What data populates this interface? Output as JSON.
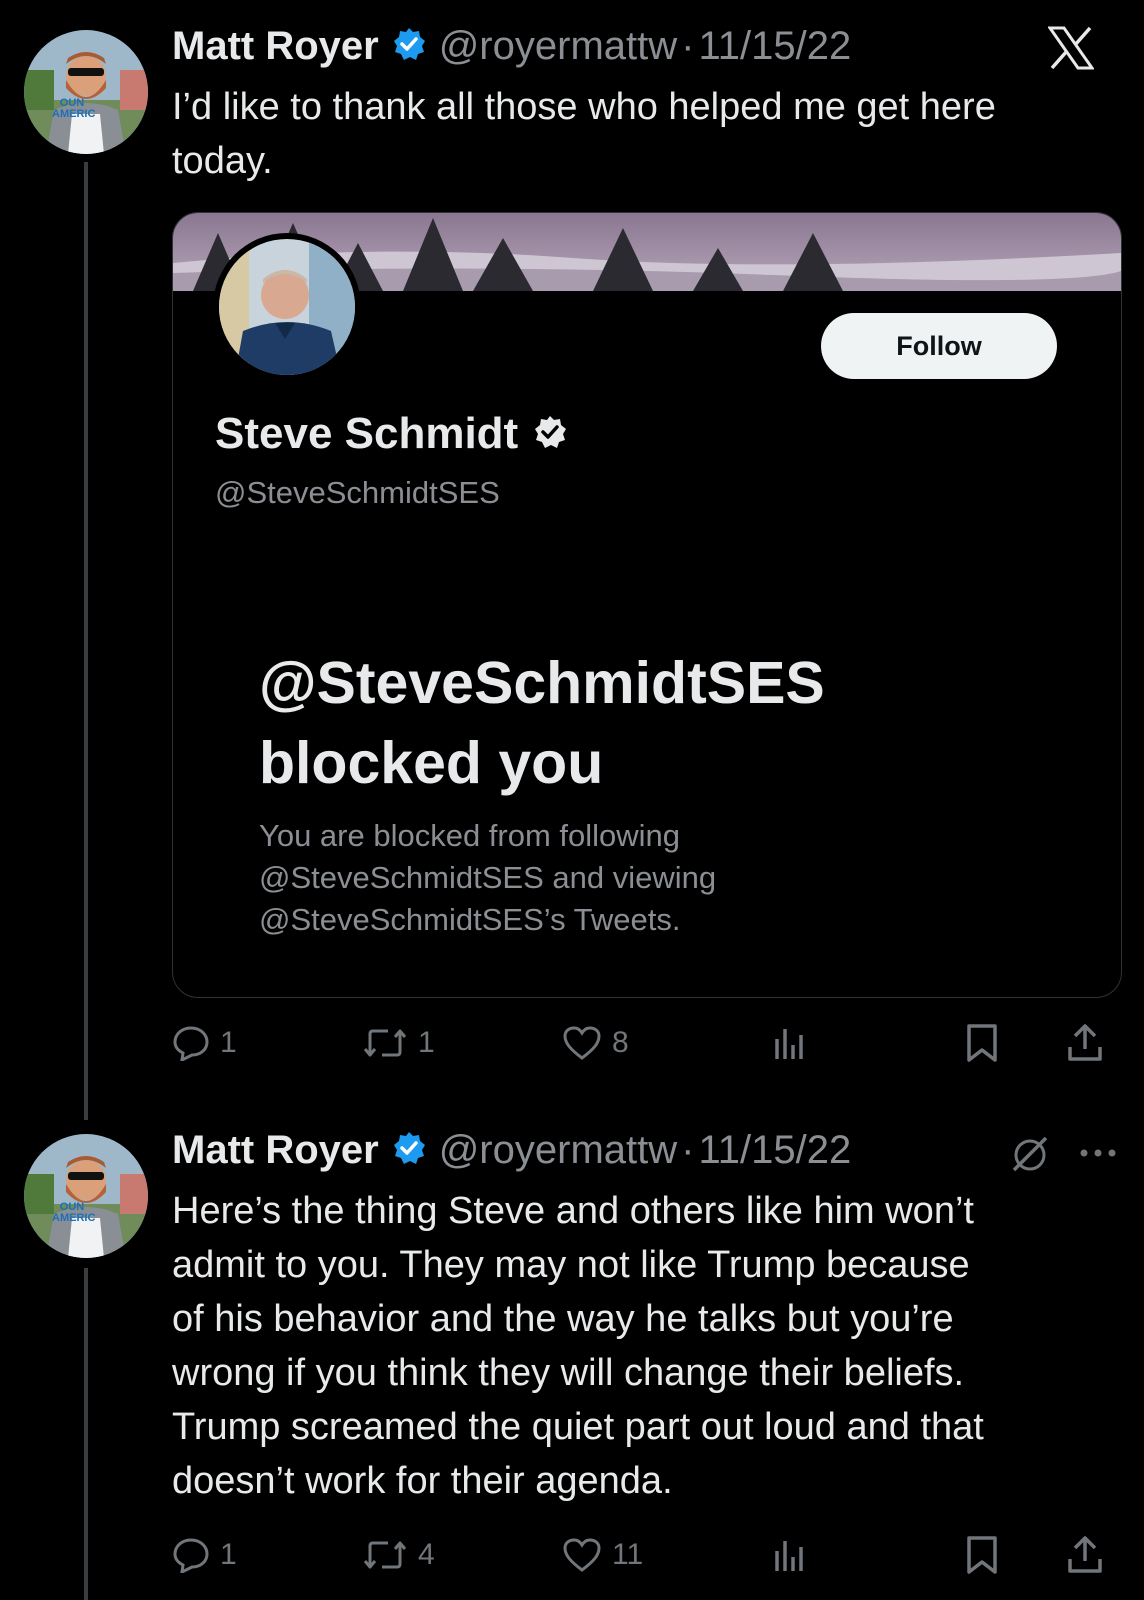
{
  "app": {
    "logo": "x-logo-icon"
  },
  "tweets": [
    {
      "author": "Matt Royer",
      "handle": "@royermattw",
      "separator": "·",
      "date": "11/15/22",
      "text_lines": [
        "I’d like to thank all those who helped me get here",
        "today."
      ],
      "avatar_shirt_text": "OUN\nAMERIC",
      "stats": {
        "replies": "1",
        "retweets": "1",
        "likes": "8"
      }
    },
    {
      "author": "Matt Royer",
      "handle": "@royermattw",
      "separator": "·",
      "date": "11/15/22",
      "text_lines": [
        "Here’s the thing Steve and others like him won’t",
        "admit to you. They may not like Trump because",
        "of his behavior and the way he talks but you’re",
        "wrong if you think they will change their beliefs.",
        "Trump screamed the quiet part out loud and that",
        "doesn’t work for their agenda."
      ],
      "stats": {
        "replies": "1",
        "retweets": "4",
        "likes": "11"
      }
    }
  ],
  "card": {
    "name": "Steve Schmidt",
    "handle": "@SteveSchmidtSES",
    "follow_label": "Follow",
    "blocked_title_line1": "@SteveSchmidtSES",
    "blocked_title_line2": "blocked you",
    "blocked_body_lines": [
      "You are blocked from following",
      "@SteveSchmidtSES and viewing",
      "@SteveSchmidtSES’s Tweets."
    ]
  },
  "colors": {
    "verified": "#1d9bf0",
    "muted": "#71767b",
    "background": "#000000"
  }
}
